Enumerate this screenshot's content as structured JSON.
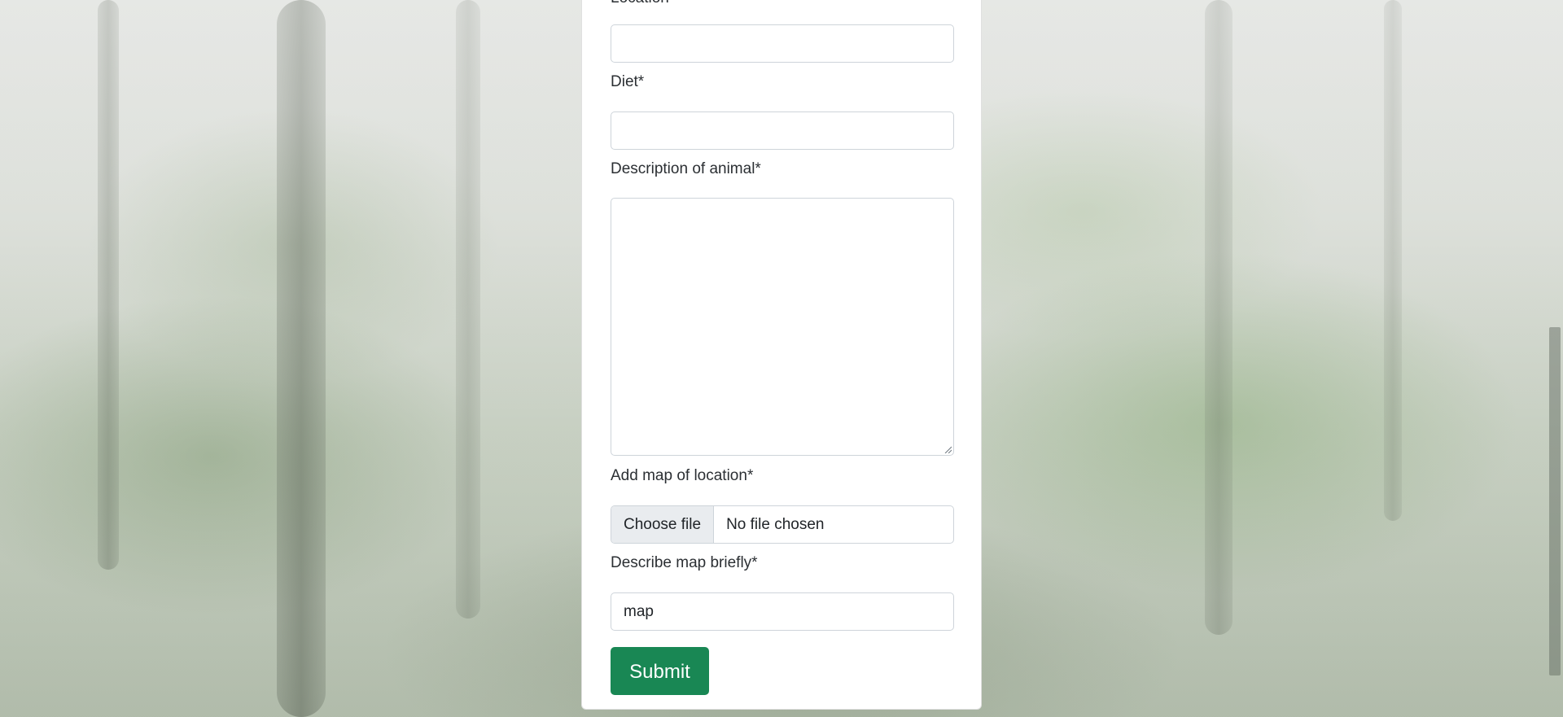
{
  "form": {
    "location": {
      "label": "Location*",
      "value": ""
    },
    "diet": {
      "label": "Diet*",
      "value": ""
    },
    "description": {
      "label": "Description of animal*",
      "value": ""
    },
    "map_file": {
      "label": "Add map of location*",
      "button_label": "Choose file",
      "status": "No file chosen"
    },
    "map_description": {
      "label": "Describe map briefly*",
      "value": "map"
    },
    "submit_label": "Submit"
  },
  "colors": {
    "submit_bg": "#198754",
    "input_border": "#ced4da",
    "file_button_bg": "#e9ecef"
  },
  "icons": {
    "textarea_resize": "resize-grip-icon"
  }
}
